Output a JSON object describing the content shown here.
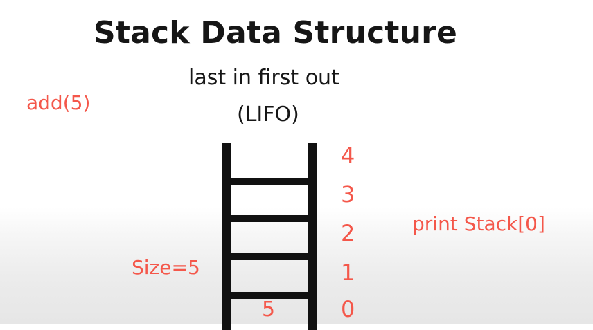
{
  "title": "Stack Data Structure",
  "subtitle": "last in first out",
  "abbreviation": "(LIFO)",
  "operations": {
    "add": "add(5)",
    "print": "print Stack[0]"
  },
  "size_label": "Size=5",
  "stack": {
    "indices": [
      "4",
      "3",
      "2",
      "1",
      "0"
    ],
    "values": [
      "5"
    ]
  },
  "colors": {
    "accent": "#f4574a",
    "ink": "#111111"
  }
}
